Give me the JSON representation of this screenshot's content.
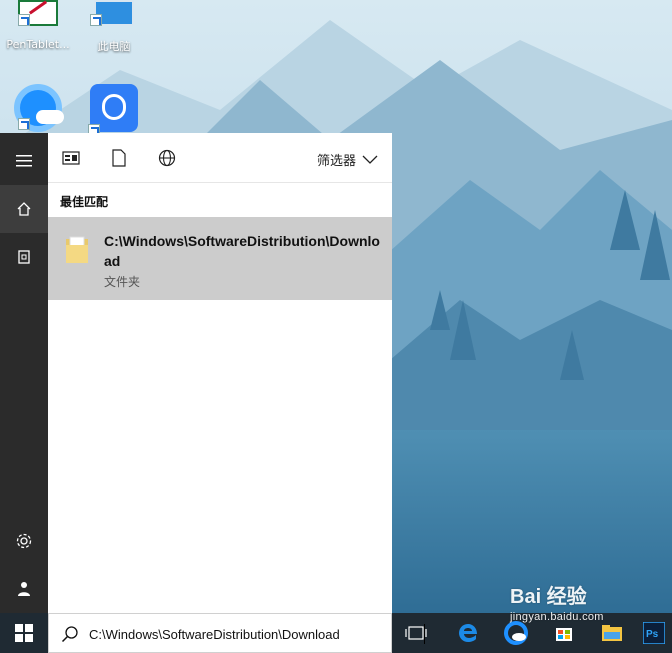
{
  "desktop": {
    "icons": [
      {
        "label": "PenTablet..."
      },
      {
        "label": "此电脑"
      }
    ]
  },
  "start_menu": {
    "filter_label": "筛选器",
    "section_title": "最佳匹配",
    "best_match": {
      "title": "C:\\Windows\\SoftwareDistribution\\Download",
      "subtitle": "文件夹"
    }
  },
  "taskbar": {
    "search_value": "C:\\Windows\\SoftwareDistribution\\Download"
  },
  "watermark": {
    "brand": "Bai 经验",
    "url": "jingyan.baidu.com"
  },
  "colors": {
    "rail": "#2b2b2b",
    "highlight": "#cccccc",
    "accent": "#1c6fd6"
  }
}
